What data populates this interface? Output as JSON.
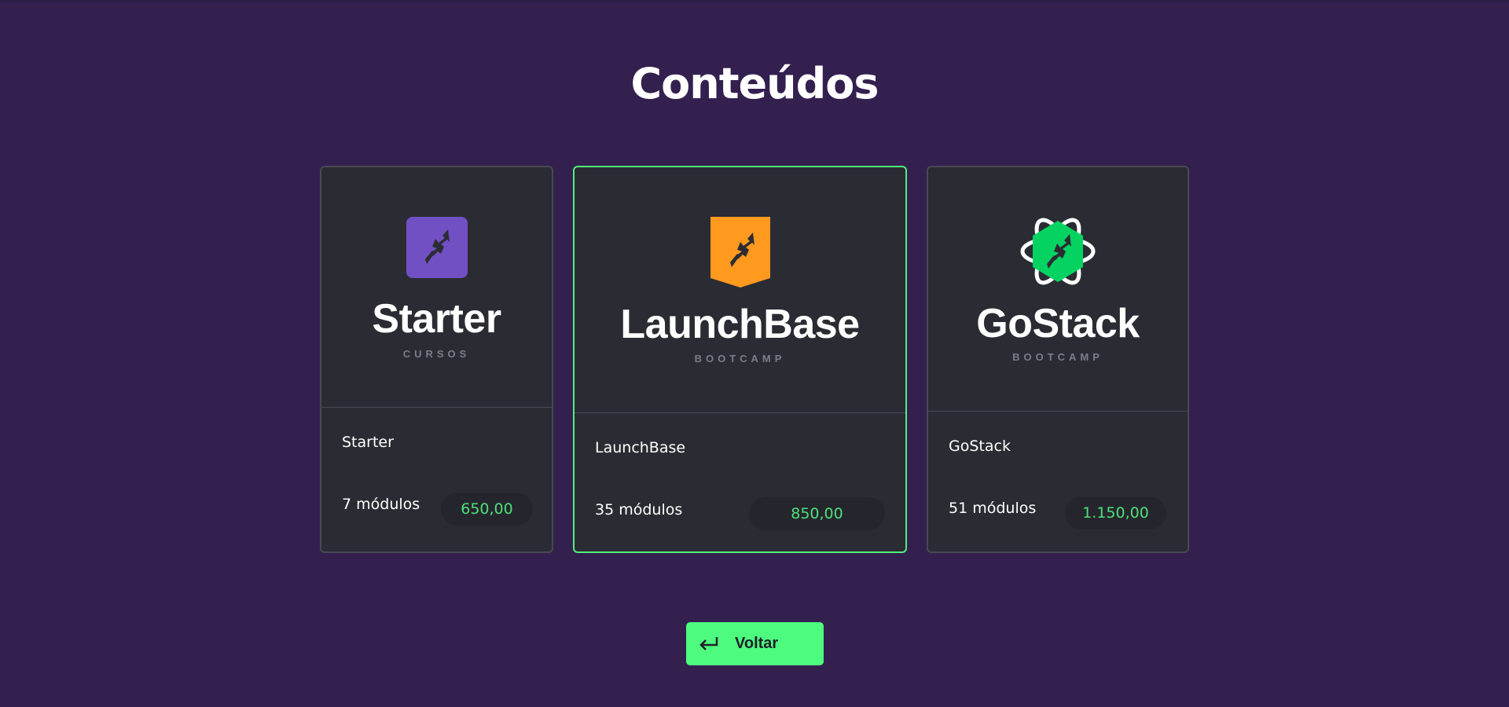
{
  "page": {
    "title": "Conteúdos",
    "background": "#33204f"
  },
  "colors": {
    "card_background": "#2b2c33",
    "card_border": "#474955",
    "featured_border": "#4ef07a",
    "price_text": "#4ee07a",
    "button_background": "#4dfb7f"
  },
  "cards": [
    {
      "logo_name": "Starter",
      "logo_subtitle": "CURSOS",
      "icon": "rocket-purple-square-icon",
      "icon_color": "#7150c4",
      "name": "Starter",
      "modules": "7 módulos",
      "price": "650,00"
    },
    {
      "logo_name": "LaunchBase",
      "logo_subtitle": "BOOTCAMP",
      "icon": "rocket-orange-shield-icon",
      "icon_color": "#ff9a1f",
      "name": "LaunchBase",
      "modules": "35 módulos",
      "price": "850,00"
    },
    {
      "logo_name": "GoStack",
      "logo_subtitle": "BOOTCAMP",
      "icon": "rocket-green-atom-icon",
      "icon_color": "#04d361",
      "name": "GoStack",
      "modules": "51 módulos",
      "price": "1.150,00"
    }
  ],
  "back_button": {
    "label": "Voltar",
    "icon": "return-arrow-icon"
  }
}
